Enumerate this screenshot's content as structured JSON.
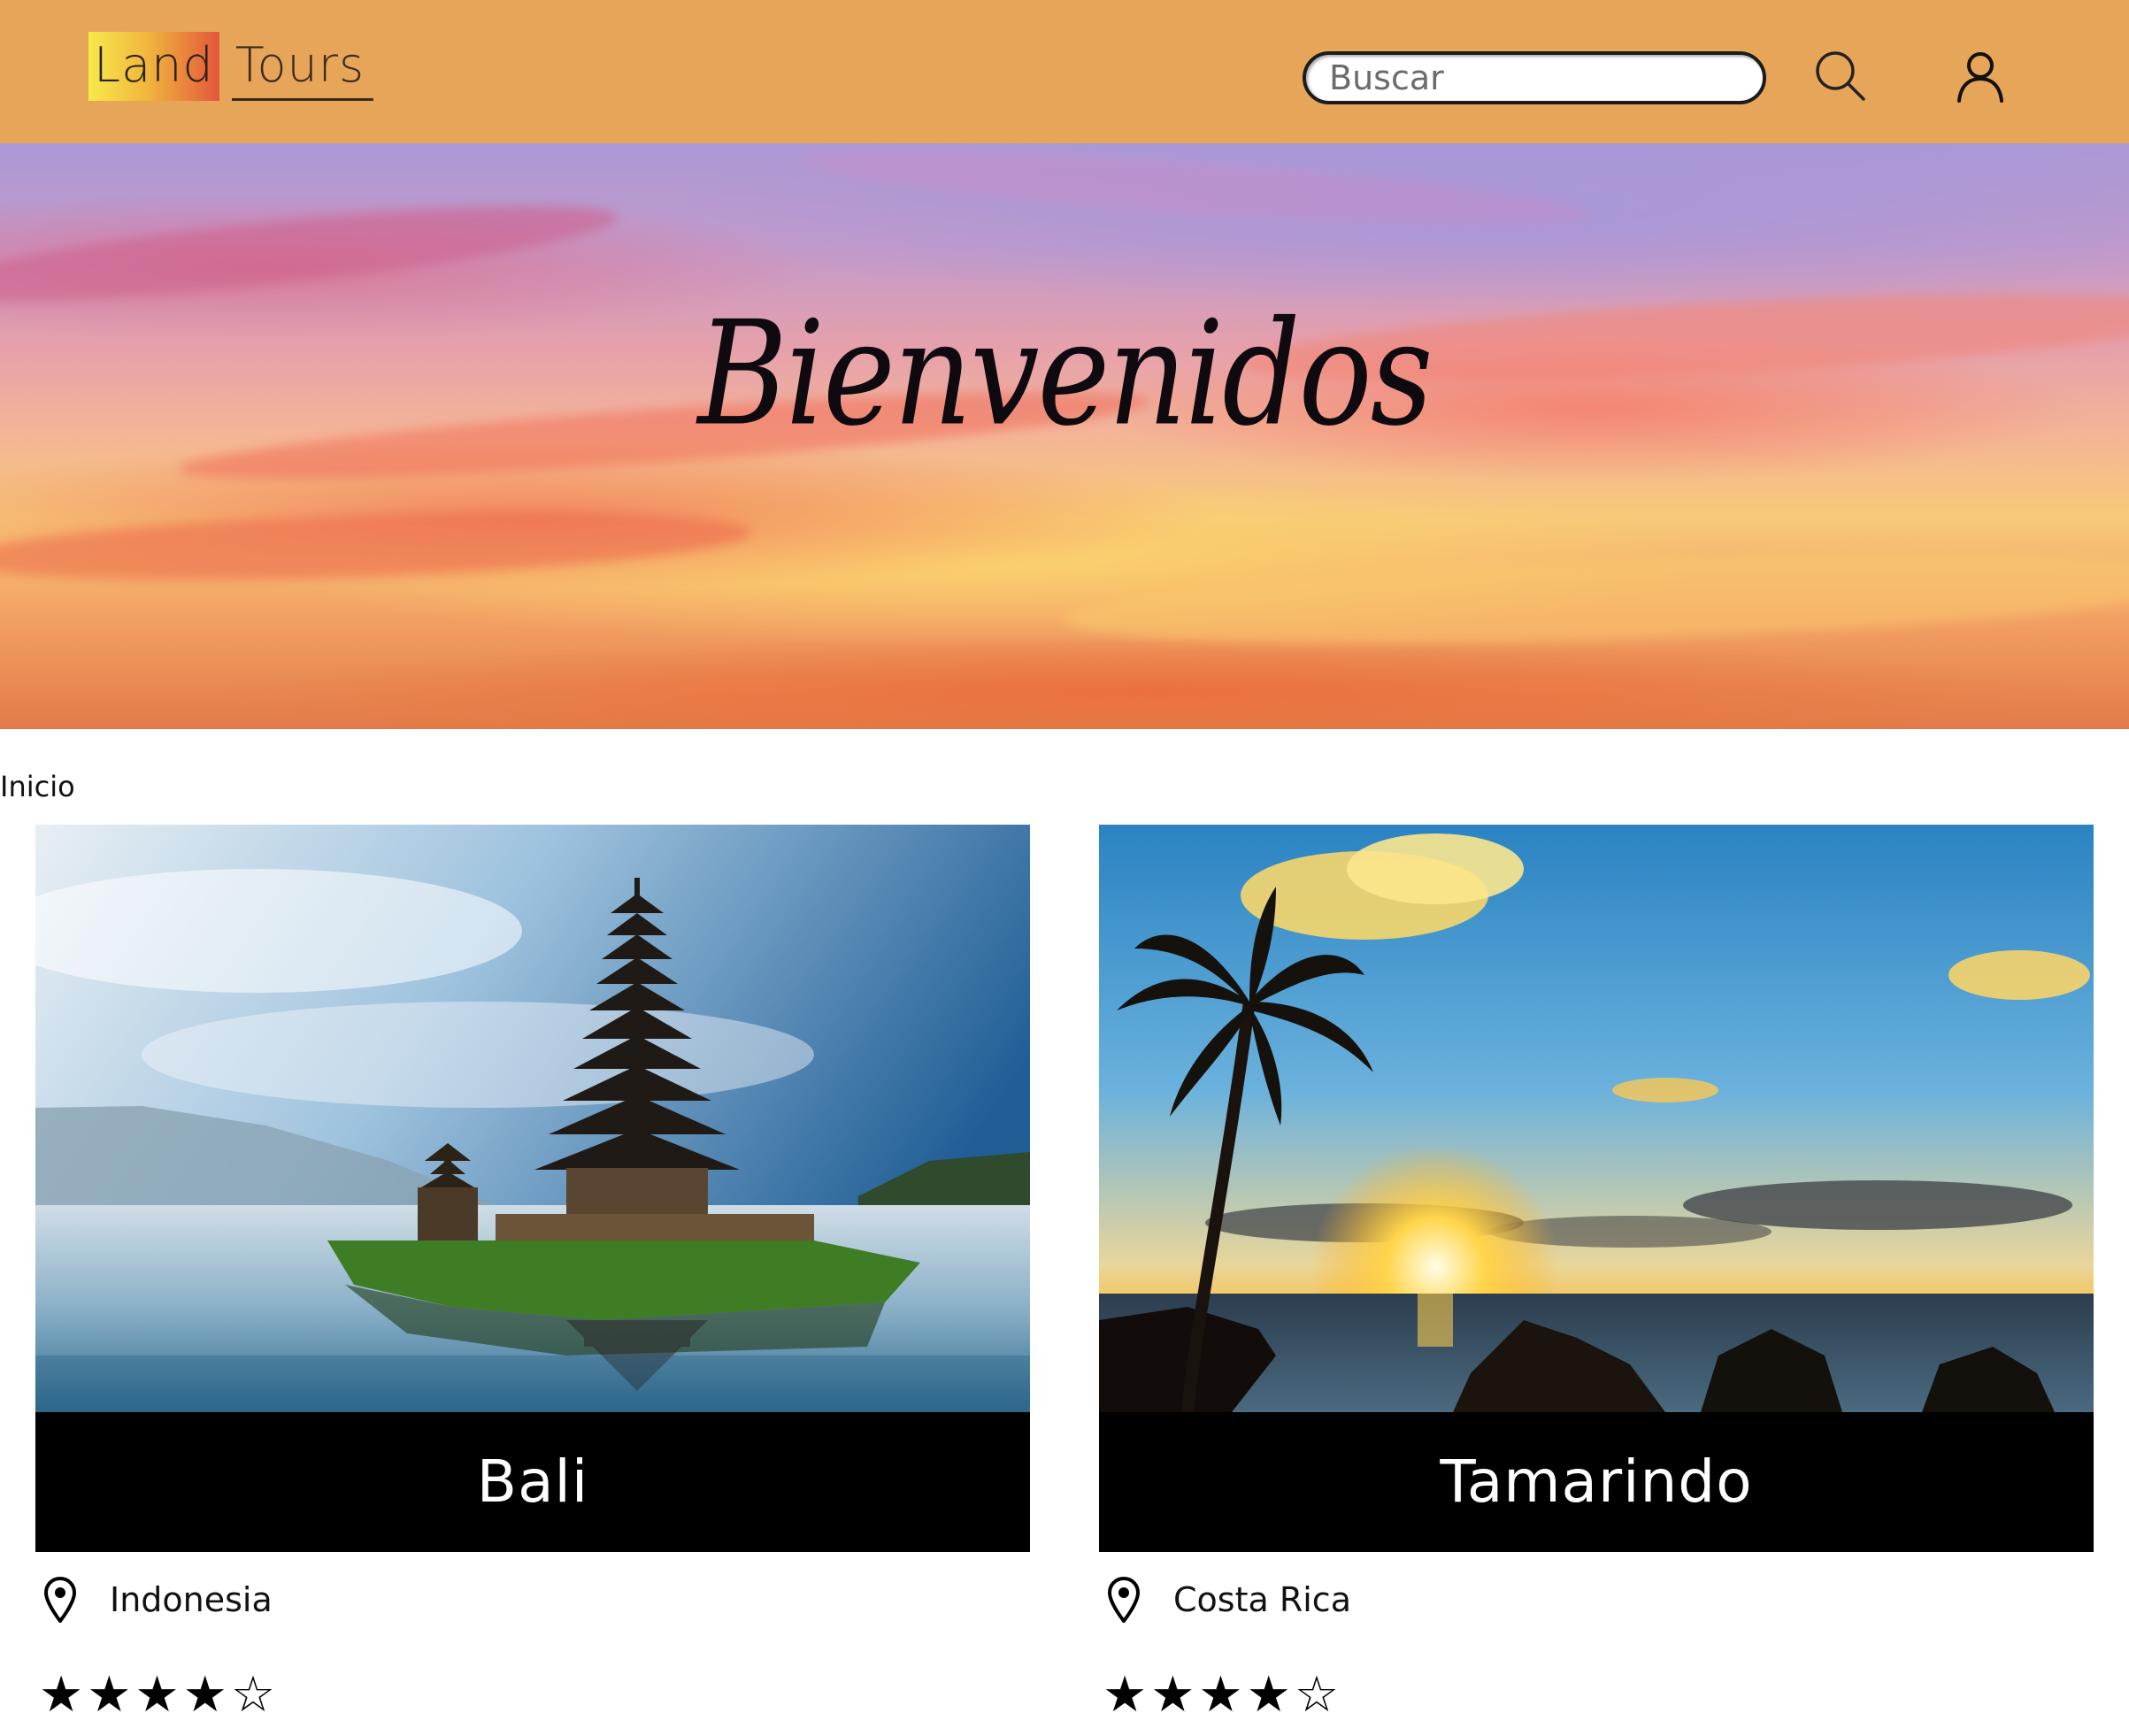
{
  "header": {
    "logo_part1": "Land",
    "logo_part2": "Tours",
    "search_placeholder": "Buscar",
    "search_icon": "search-icon",
    "user_icon": "user-icon",
    "background": "#E7A55A"
  },
  "hero": {
    "title": "Bienvenidos"
  },
  "breadcrumb": {
    "label": "Inicio"
  },
  "destinations": [
    {
      "name": "Bali",
      "location": "Indonesia",
      "rating": 4,
      "rating_max": 5
    },
    {
      "name": "Tamarindo",
      "location": "Costa Rica",
      "rating": 4,
      "rating_max": 5
    }
  ]
}
